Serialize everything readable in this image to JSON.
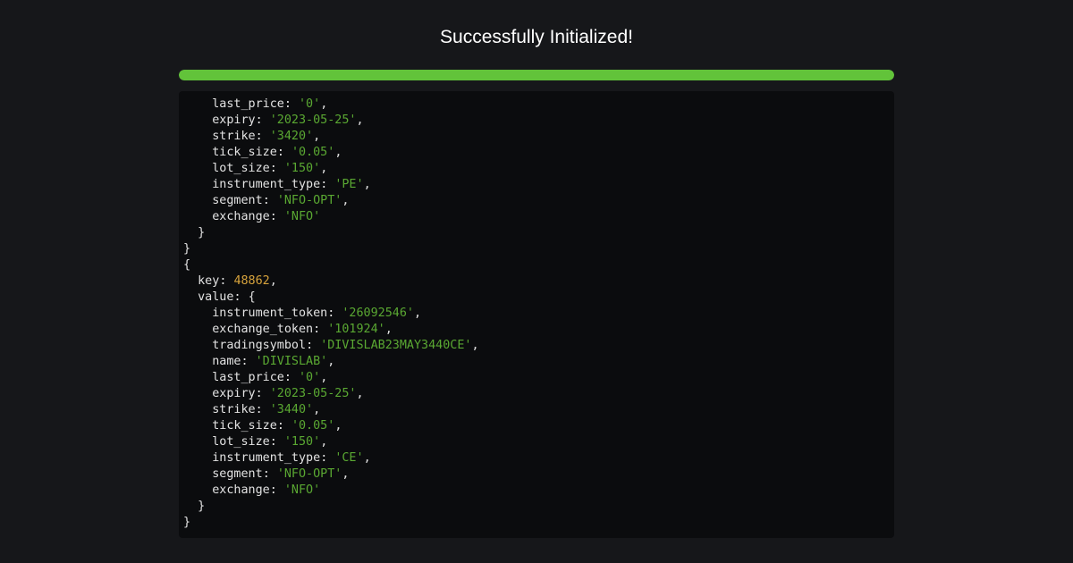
{
  "header": {
    "title": "Successfully Initialized!"
  },
  "progress": {
    "percent": 100
  },
  "colors": {
    "background": "#16171a",
    "console_background": "#0b0c0e",
    "progress_fill": "#62c33a",
    "string": "#5aa832",
    "number": "#d7a33c",
    "text": "#e3e3e3"
  },
  "console": {
    "lines": [
      {
        "indent": 4,
        "key": "last_price",
        "value": "'0'",
        "type": "str",
        "trail": ","
      },
      {
        "indent": 4,
        "key": "expiry",
        "value": "'2023-05-25'",
        "type": "str",
        "trail": ","
      },
      {
        "indent": 4,
        "key": "strike",
        "value": "'3420'",
        "type": "str",
        "trail": ","
      },
      {
        "indent": 4,
        "key": "tick_size",
        "value": "'0.05'",
        "type": "str",
        "trail": ","
      },
      {
        "indent": 4,
        "key": "lot_size",
        "value": "'150'",
        "type": "str",
        "trail": ","
      },
      {
        "indent": 4,
        "key": "instrument_type",
        "value": "'PE'",
        "type": "str",
        "trail": ","
      },
      {
        "indent": 4,
        "key": "segment",
        "value": "'NFO-OPT'",
        "type": "str",
        "trail": ","
      },
      {
        "indent": 4,
        "key": "exchange",
        "value": "'NFO'",
        "type": "str",
        "trail": ""
      },
      {
        "indent": 2,
        "text": "}"
      },
      {
        "indent": 0,
        "text": "}"
      },
      {
        "indent": 0,
        "text": "{"
      },
      {
        "indent": 2,
        "key": "key",
        "value": "48862",
        "type": "num",
        "trail": ","
      },
      {
        "indent": 2,
        "key": "value",
        "value": "{",
        "type": "punc",
        "trail": ""
      },
      {
        "indent": 4,
        "key": "instrument_token",
        "value": "'26092546'",
        "type": "str",
        "trail": ","
      },
      {
        "indent": 4,
        "key": "exchange_token",
        "value": "'101924'",
        "type": "str",
        "trail": ","
      },
      {
        "indent": 4,
        "key": "tradingsymbol",
        "value": "'DIVISLAB23MAY3440CE'",
        "type": "str",
        "trail": ","
      },
      {
        "indent": 4,
        "key": "name",
        "value": "'DIVISLAB'",
        "type": "str",
        "trail": ","
      },
      {
        "indent": 4,
        "key": "last_price",
        "value": "'0'",
        "type": "str",
        "trail": ","
      },
      {
        "indent": 4,
        "key": "expiry",
        "value": "'2023-05-25'",
        "type": "str",
        "trail": ","
      },
      {
        "indent": 4,
        "key": "strike",
        "value": "'3440'",
        "type": "str",
        "trail": ","
      },
      {
        "indent": 4,
        "key": "tick_size",
        "value": "'0.05'",
        "type": "str",
        "trail": ","
      },
      {
        "indent": 4,
        "key": "lot_size",
        "value": "'150'",
        "type": "str",
        "trail": ","
      },
      {
        "indent": 4,
        "key": "instrument_type",
        "value": "'CE'",
        "type": "str",
        "trail": ","
      },
      {
        "indent": 4,
        "key": "segment",
        "value": "'NFO-OPT'",
        "type": "str",
        "trail": ","
      },
      {
        "indent": 4,
        "key": "exchange",
        "value": "'NFO'",
        "type": "str",
        "trail": ""
      },
      {
        "indent": 2,
        "text": "}"
      },
      {
        "indent": 0,
        "text": "}"
      }
    ]
  }
}
